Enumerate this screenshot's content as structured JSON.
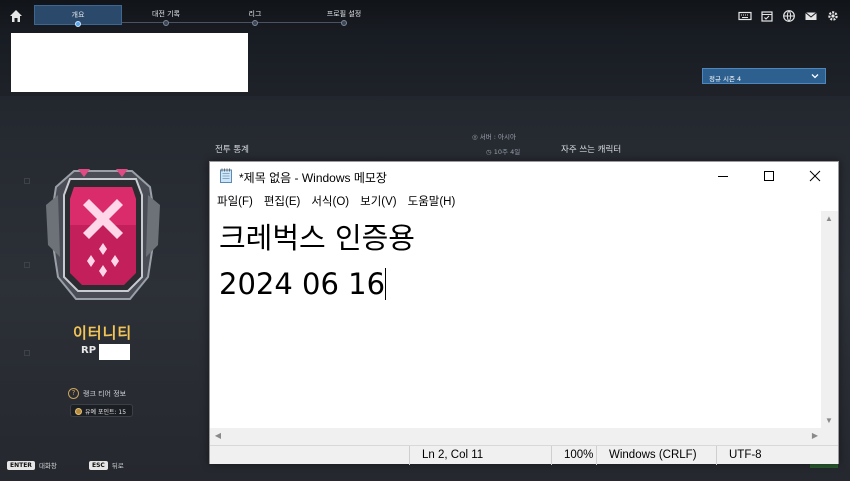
{
  "game": {
    "tabs": [
      {
        "label": "개요",
        "active": true
      },
      {
        "label": "대전 기록",
        "active": false
      },
      {
        "label": "리그",
        "active": false
      },
      {
        "label": "프로필 설정",
        "active": false
      }
    ],
    "season_select": "정규 시즌 4",
    "stats_title": "전투 통계",
    "server": "서버 : 아시아",
    "season_age": "10주 4일",
    "favorite_characters": "자주 쓰는 캐릭터",
    "rank_name": "이터니티",
    "rp_label": "RP",
    "tier_info": "랭크 티어 정보",
    "merit_points": "유예 포인트: 15",
    "hints": [
      {
        "key": "ENTER",
        "label": "대화창"
      },
      {
        "key": "ESC",
        "label": "뒤로"
      }
    ],
    "accent_color": "#2d5f8f",
    "rank_color": "#f3c457"
  },
  "notepad": {
    "title": "*제목 없음 - Windows 메모장",
    "menu": [
      "파일(F)",
      "편집(E)",
      "서식(O)",
      "보기(V)",
      "도움말(H)"
    ],
    "lines": [
      "크레벅스 인증용",
      "2024 06 16"
    ],
    "status": {
      "position": "Ln 2, Col 11",
      "zoom": "100%",
      "line_ending": "Windows (CRLF)",
      "encoding": "UTF-8"
    }
  }
}
